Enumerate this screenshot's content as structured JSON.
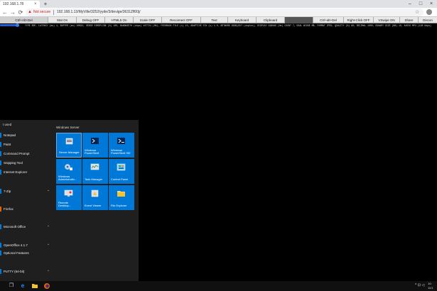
{
  "browser": {
    "tab_title": "192.168.1.78",
    "tab_close": "×",
    "new_tab": "+",
    "win_min": "–",
    "win_max": "□",
    "win_close": "×",
    "back": "←",
    "forward": "→",
    "reload": "⟳",
    "security_label": "Not secure",
    "url": "192.168.1.13/MyVille/3252/yyde/3/devige/3631Zfl00j/",
    "star": "☆",
    "menu": "⋮"
  },
  "remote_toolbar": {
    "buttons": [
      "Ctrl+Alt+Del",
      "Stat On",
      "Debug OFF",
      "HTML5 On",
      "Scale OFF",
      "Reconnect OFF",
      "Text",
      "Keyboard",
      "Clipboard",
      "",
      "Ctrl+alt+Del",
      "Right-Click OFF",
      "VSwipe ON",
      "Share",
      "Discon"
    ]
  },
  "stats_line": "TYPE RDP, LATENCY (ms) 1, BUFFER (ms) 90592, SENSE SIMSPLINE (%) 100, BANDWIDTH (kbps) 107721 (0%), FEEDBACK FILE (s) 15, ADAPTIVE FIX (s) 1.0, NETWORK 9999(OUT (duplex), DISPLAY CANVAS (Hz) COUNT 7, DEAL WIDGE MB, FORMAT JPEG, QUALITY (%) 90, DECIMAL 1000, BINARY SIZE (KB) 19, AUDIO MP3 (128 kbps)",
  "start_menu": {
    "most_used_header": "t used",
    "items": [
      {
        "label": "Notepad",
        "chevron": ""
      },
      {
        "label": "Paint",
        "chevron": ""
      },
      {
        "label": "Command Prompt",
        "chevron": ""
      },
      {
        "label": "Snipping Tool",
        "chevron": ""
      },
      {
        "label": "Internet Explorer",
        "chevron": ""
      },
      {
        "label": "7-Zip",
        "chevron": "⌄"
      },
      {
        "label": "Firefox",
        "chevron": ""
      },
      {
        "label": "Microsoft Office",
        "chevron": "⌄"
      },
      {
        "label": "OpenOffice 4.1.7",
        "chevron": "⌄"
      },
      {
        "label": "Optional Features",
        "chevron": ""
      },
      {
        "label": "PuTTY (64-bit)",
        "chevron": "⌄"
      }
    ],
    "tile_group": "Windows Server",
    "tiles": [
      {
        "label": "Server Manager",
        "icon": "server-manager-icon"
      },
      {
        "label": "Windows PowerShell",
        "icon": "powershell-icon"
      },
      {
        "label": "Windows PowerShell ISE",
        "icon": "powershell-ise-icon"
      },
      {
        "label": "Windows Administrativ...",
        "icon": "admin-tools-icon"
      },
      {
        "label": "Task Manager",
        "icon": "task-manager-icon"
      },
      {
        "label": "Control Panel",
        "icon": "control-panel-icon"
      },
      {
        "label": "Remote Desktop...",
        "icon": "remote-desktop-icon"
      },
      {
        "label": "Event Viewer",
        "icon": "event-viewer-icon"
      },
      {
        "label": "File Explorer",
        "icon": "file-explorer-icon"
      }
    ]
  },
  "taskbar": {
    "tray": "^ ⊡ ◁",
    "clock_time": "10:",
    "clock_date": "11/1"
  },
  "colors": {
    "tile_blue": "#0078d7",
    "menu_bg": "#1f1f1f",
    "taskbar_bg": "#101010"
  }
}
